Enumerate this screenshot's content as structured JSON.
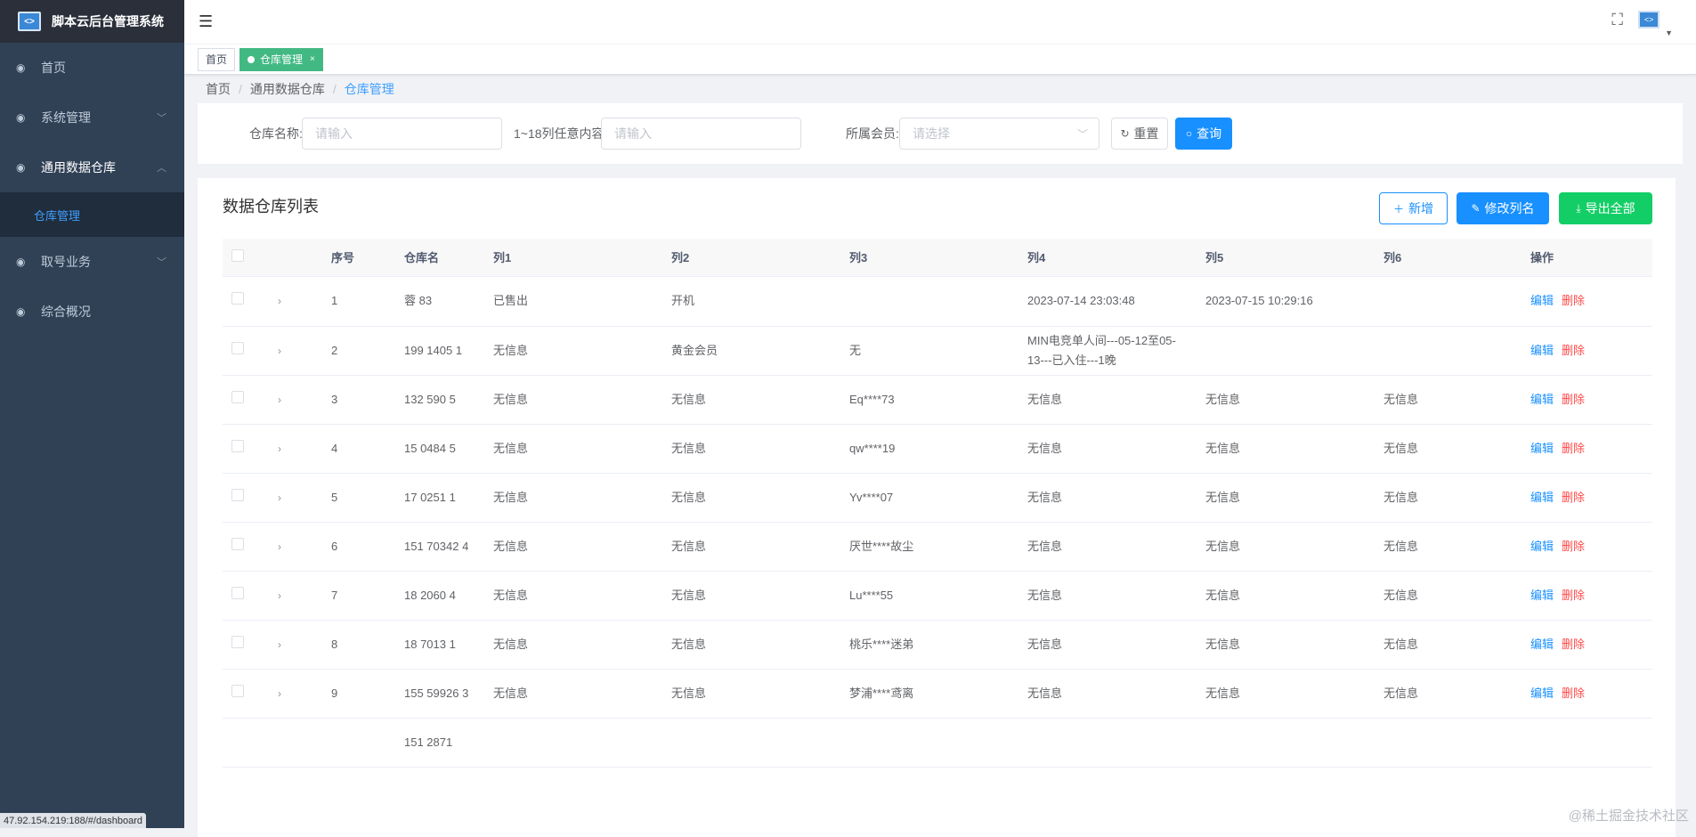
{
  "app": {
    "title": "脚本云后台管理系统",
    "logo_icon": "monitor-code-icon"
  },
  "sidebar": {
    "items": [
      {
        "label": "首页",
        "icon": "dashboard-icon",
        "has_children": false
      },
      {
        "label": "系统管理",
        "icon": "dashboard-icon",
        "has_children": true,
        "open": false
      },
      {
        "label": "通用数据仓库",
        "icon": "dashboard-icon",
        "has_children": true,
        "open": true
      },
      {
        "label": "取号业务",
        "icon": "dashboard-icon",
        "has_children": true,
        "open": false
      },
      {
        "label": "综合概况",
        "icon": "dashboard-icon",
        "has_children": false
      }
    ],
    "sub_items": [
      {
        "label": "仓库管理"
      }
    ]
  },
  "navbar": {
    "hamburger_icon": "hamburger-icon",
    "fullscreen_icon": "fullscreen-icon",
    "avatar_icon": "avatar-monitor-icon"
  },
  "tags": [
    {
      "label": "首页",
      "active": false
    },
    {
      "label": "仓库管理",
      "active": true,
      "close": "×"
    }
  ],
  "breadcrumb": [
    "首页",
    "/",
    "通用数据仓库",
    "/",
    "仓库管理"
  ],
  "search": {
    "name_label": "仓库名称:",
    "name_placeholder": "请输入",
    "cols_label": "1~18列任意内容:",
    "cols_placeholder": "请输入",
    "member_label": "所属会员:",
    "member_placeholder": "请选择",
    "reset_label": "重置",
    "query_label": "查询"
  },
  "panel": {
    "title": "数据仓库列表",
    "add_label": "新增",
    "rename_label": "修改列名",
    "export_label": "导出全部"
  },
  "table": {
    "headers": [
      "序号",
      "仓库名",
      "列1",
      "列2",
      "列3",
      "列4",
      "列5",
      "列6",
      "操作"
    ],
    "edit_label": "编辑",
    "delete_label": "删除",
    "rows": [
      {
        "no": "1",
        "name": "蓉    83",
        "c1": "已售出",
        "c2": "开机",
        "c3": "",
        "c4": "2023-07-14 23:03:48",
        "c5": "2023-07-15 10:29:16",
        "c6": ""
      },
      {
        "no": "2",
        "name": "199    1405 1",
        "c1": "无信息",
        "c2": "黄金会员",
        "c3": "无",
        "c4": "MIN电竞单人间---05-12至05-13---已入住---1晚",
        "c5": "",
        "c6": ""
      },
      {
        "no": "3",
        "name": "132    590 5",
        "c1": "无信息",
        "c2": "无信息",
        "c3": "Eq****73",
        "c4": "无信息",
        "c5": "无信息",
        "c6": "无信息"
      },
      {
        "no": "4",
        "name": "15    0484 5",
        "c1": "无信息",
        "c2": "无信息",
        "c3": "qw****19",
        "c4": "无信息",
        "c5": "无信息",
        "c6": "无信息"
      },
      {
        "no": "5",
        "name": "17    0251 1",
        "c1": "无信息",
        "c2": "无信息",
        "c3": "Yv****07",
        "c4": "无信息",
        "c5": "无信息",
        "c6": "无信息"
      },
      {
        "no": "6",
        "name": "151    70342 4",
        "c1": "无信息",
        "c2": "无信息",
        "c3": "厌世****故尘",
        "c4": "无信息",
        "c5": "无信息",
        "c6": "无信息"
      },
      {
        "no": "7",
        "name": "18    2060 4",
        "c1": "无信息",
        "c2": "无信息",
        "c3": "Lu****55",
        "c4": "无信息",
        "c5": "无信息",
        "c6": "无信息"
      },
      {
        "no": "8",
        "name": "18    7013 1",
        "c1": "无信息",
        "c2": "无信息",
        "c3": "桃乐****迷弟",
        "c4": "无信息",
        "c5": "无信息",
        "c6": "无信息"
      },
      {
        "no": "9",
        "name": "155    59926 3",
        "c1": "无信息",
        "c2": "无信息",
        "c3": "梦浦****鸢离",
        "c4": "无信息",
        "c5": "无信息",
        "c6": "无信息"
      },
      {
        "no": "",
        "name": "151    2871",
        "c1": "",
        "c2": "",
        "c3": "",
        "c4": "",
        "c5": "",
        "c6": ""
      }
    ]
  },
  "status_url": "47.92.154.219:188/#/dashboard",
  "watermark": "@稀土掘金技术社区",
  "colors": {
    "sidebar": "#304156",
    "primary": "#1890ff",
    "success": "#13ce66",
    "danger": "#ff4949",
    "tag_active": "#42b983"
  }
}
